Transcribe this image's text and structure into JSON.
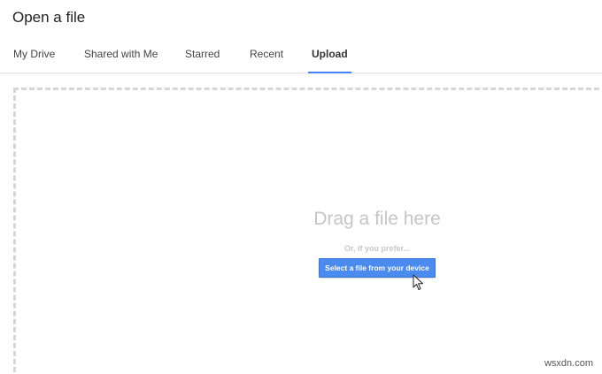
{
  "dialog": {
    "title": "Open a file"
  },
  "tabs": [
    {
      "label": "My Drive",
      "active": false
    },
    {
      "label": "Shared with Me",
      "active": false
    },
    {
      "label": "Starred",
      "active": false
    },
    {
      "label": "Recent",
      "active": false
    },
    {
      "label": "Upload",
      "active": true
    }
  ],
  "upload": {
    "heading": "Drag a file here",
    "alt_text": "Or, if you prefer...",
    "select_button_label": "Select a file from your device"
  },
  "watermark": "wsxdn.com",
  "colors": {
    "accent": "#4285f4",
    "button": "#4b8bf0",
    "dropzone_border": "#d6d6d6"
  }
}
